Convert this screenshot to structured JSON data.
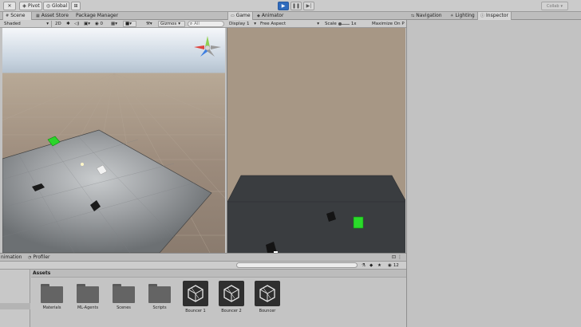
{
  "toolbar": {
    "pivot_label": "Pivot",
    "global_label": "Global",
    "collab_label": "Collab"
  },
  "scene_panel": {
    "tabs": [
      "Scene",
      "Asset Store",
      "Package Manager"
    ],
    "shading_mode": "Shaded",
    "view_2d_label": "2D",
    "gizmos_label": "Gizmos",
    "search_placeholder": "All"
  },
  "game_panel": {
    "tabs": [
      "Game",
      "Animator"
    ],
    "display": "Display 1",
    "aspect": "Free Aspect",
    "scale_label": "Scale",
    "scale_value": "1x",
    "maximize_label": "Maximize On P"
  },
  "right_panel": {
    "tabs": [
      "Navigation",
      "Lighting",
      "Inspector"
    ]
  },
  "bottom_panel": {
    "tabs": [
      "nimation",
      "Profiler"
    ],
    "visible_count": "12",
    "assets_header": "Assets",
    "items": [
      {
        "label": "Materials",
        "kind": "folder"
      },
      {
        "label": "ML-Agents",
        "kind": "folder"
      },
      {
        "label": "Scenes",
        "kind": "folder"
      },
      {
        "label": "Scripts",
        "kind": "folder"
      },
      {
        "label": "Bouncer 1",
        "kind": "prefab"
      },
      {
        "label": "Bouncer 2",
        "kind": "prefab"
      },
      {
        "label": "Bouncer",
        "kind": "prefab"
      }
    ]
  },
  "colors": {
    "accent": "#2f6bbd",
    "agent_green": "#22dd22",
    "editor_bg": "#c2c2c2"
  }
}
